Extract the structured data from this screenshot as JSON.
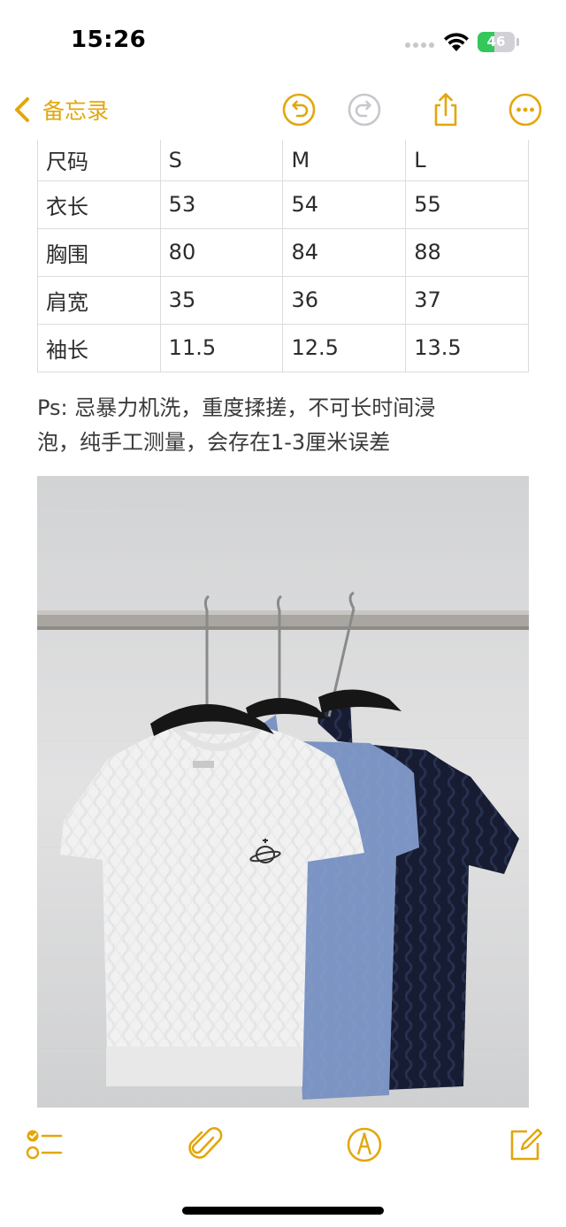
{
  "status_bar": {
    "time": "15:26",
    "battery_level": 46,
    "battery_text": "46",
    "battery_color": "#34c759"
  },
  "nav": {
    "back_label": "备忘录",
    "accent_color": "#e2a70c",
    "icons": [
      "chevron-left-icon",
      "undo-icon",
      "redo-icon",
      "share-icon",
      "more-icon"
    ]
  },
  "size_table": {
    "header": [
      "尺码",
      "S",
      "M",
      "L"
    ],
    "rows": [
      [
        "衣长",
        "53",
        "54",
        "55"
      ],
      [
        "胸围",
        "80",
        "84",
        "88"
      ],
      [
        "肩宽",
        "35",
        "36",
        "37"
      ],
      [
        "袖长",
        "11.5",
        "12.5",
        "13.5"
      ]
    ]
  },
  "note": {
    "line1": "Ps: 忌暴力机洗，重度揉搓，不可长时间浸",
    "line2": "泡，纯手工测量，会存在1-3厘米误差"
  },
  "toolbar": {
    "icons": [
      "checklist-icon",
      "paperclip-icon",
      "markup-pen-icon",
      "compose-icon"
    ]
  }
}
